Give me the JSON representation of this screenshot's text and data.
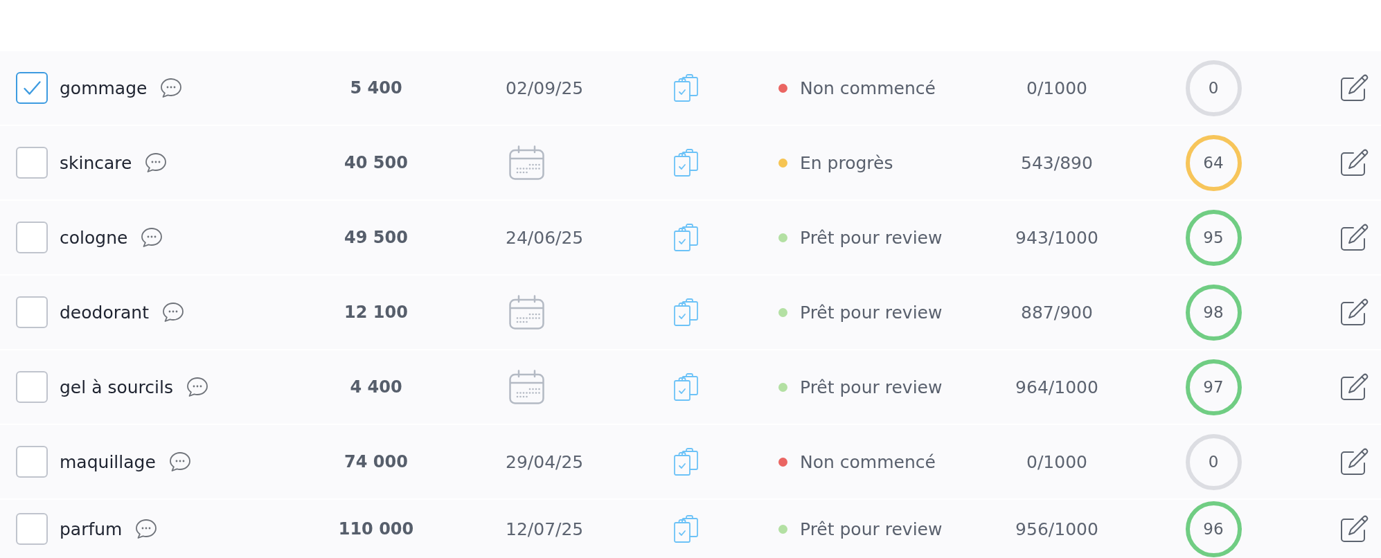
{
  "rows": [
    {
      "selected": true,
      "keyword": "gommage",
      "volume": "5 400",
      "due_date": "02/09/25",
      "status": {
        "label": "Non commencé",
        "color": "#ea6562"
      },
      "word_count": "0/1000",
      "score": {
        "value": "0",
        "color": "#dcdde2"
      }
    },
    {
      "selected": false,
      "keyword": "skincare",
      "volume": "40 500",
      "status": {
        "label": "En progrès",
        "color": "#f6c452"
      },
      "word_count": "543/890",
      "score": {
        "value": "64",
        "color": "#f7c55a"
      }
    },
    {
      "selected": false,
      "keyword": "cologne",
      "volume": "49 500",
      "due_date": "24/06/25",
      "status": {
        "label": "Prêt pour review",
        "color": "#b3e0a3"
      },
      "word_count": "943/1000",
      "score": {
        "value": "95",
        "color": "#70cd83"
      }
    },
    {
      "selected": false,
      "keyword": "deodorant",
      "volume": "12 100",
      "status": {
        "label": "Prêt pour review",
        "color": "#b3e0a3"
      },
      "word_count": "887/900",
      "score": {
        "value": "98",
        "color": "#70cd83"
      }
    },
    {
      "selected": false,
      "keyword": "gel à sourcils",
      "volume": "4 400",
      "status": {
        "label": "Prêt pour review",
        "color": "#b3e0a3"
      },
      "word_count": "964/1000",
      "score": {
        "value": "97",
        "color": "#70cd83"
      }
    },
    {
      "selected": false,
      "keyword": "maquillage",
      "volume": "74 000",
      "due_date": "29/04/25",
      "status": {
        "label": "Non commencé",
        "color": "#ea6562"
      },
      "word_count": "0/1000",
      "score": {
        "value": "0",
        "color": "#dcdde2"
      }
    },
    {
      "selected": false,
      "keyword": "parfum",
      "volume": "110 000",
      "due_date": "12/07/25",
      "status": {
        "label": "Prêt pour review",
        "color": "#b3e0a3"
      },
      "word_count": "956/1000",
      "score": {
        "value": "96",
        "color": "#70cd83"
      }
    }
  ]
}
